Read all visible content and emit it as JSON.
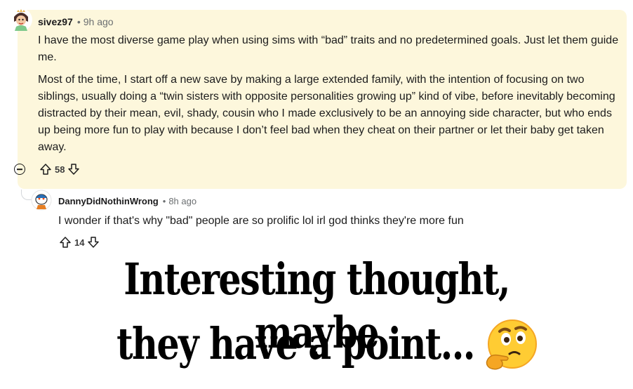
{
  "comment1": {
    "username": "sivez97",
    "separator": "•",
    "time": "9h ago",
    "paragraphs": [
      "I have the most diverse game play when using sims with “bad” traits and no predetermined goals. Just let them guide me.",
      "Most of the time, I start off a new save by making a large extended family, with the intention of focusing on two siblings, usually doing a “twin sisters with opposite personalities growing up” kind of vibe, before inevitably becoming distracted by their mean, evil, shady, cousin who I made exclusively to be an annoying side character, but who ends up being more fun to play with because I don’t feel bad when they cheat on their partner or let their baby get taken away."
    ],
    "votes": "58",
    "collapse_icon": "minus-circle-icon",
    "upvote_icon": "arrow-up-icon",
    "downvote_icon": "arrow-down-icon",
    "background": "#fdf7dc"
  },
  "comment2": {
    "username": "DannyDidNothinWrong",
    "separator": "•",
    "time": "8h ago",
    "text": "I wonder if that's why \"bad\" people are so prolific lol irl god thinks they're more fun",
    "votes": "14"
  },
  "caption": {
    "line1": "Interesting thought, maybe",
    "line2": "they have a point...",
    "emoji": "thinking-face-emoji"
  }
}
